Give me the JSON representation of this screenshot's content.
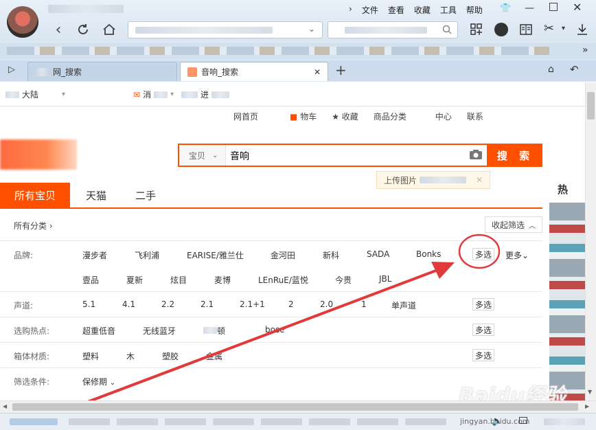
{
  "browser": {
    "menu": [
      "文件",
      "查看",
      "收藏",
      "工具",
      "帮助"
    ],
    "tabs": [
      {
        "label": "网_搜索"
      },
      {
        "label": "音响_搜索"
      }
    ],
    "favorites": [
      {
        "label": "大陆"
      },
      {
        "label": "消"
      },
      {
        "label": "进"
      }
    ]
  },
  "site": {
    "top_nav": [
      "网首页",
      "物车",
      "收藏",
      "商品分类",
      "中心",
      "联系"
    ],
    "search": {
      "category": "宝贝",
      "query": "音响",
      "button": "搜 索",
      "tip": "上传图片"
    },
    "tabs": [
      {
        "label": "所有宝贝",
        "active": true
      },
      {
        "label": "天猫",
        "active": false
      },
      {
        "label": "二手",
        "active": false
      }
    ],
    "breadcrumb": "所有分类",
    "collapse_filter": "收起筛选",
    "right_panel_title": "热",
    "filters": {
      "brand": {
        "label": "品牌:",
        "row1": [
          "漫步者",
          "飞利浦",
          "EARISE/雅兰仕",
          "金河田",
          "新科",
          "SADA",
          "Bonks"
        ],
        "row2": [
          "壹品",
          "夏新",
          "炫目",
          "麦博",
          "LEnRuE/蓝悦",
          "今贵",
          "JBL"
        ],
        "multi": "多选",
        "more": "更多"
      },
      "channel": {
        "label": "声道:",
        "items": [
          "5.1",
          "4.1",
          "2.2",
          "2.1",
          "2.1+1",
          "2",
          "2.0",
          "1",
          "单声道"
        ],
        "multi": "多选"
      },
      "hot": {
        "label": "选购热点:",
        "items": [
          "超重低音",
          "无线蓝牙",
          "顿",
          "bose"
        ],
        "multi": "多选"
      },
      "material": {
        "label": "箱体材质:",
        "items": [
          "塑料",
          "木",
          "塑胶",
          "金属"
        ],
        "multi": "多选"
      },
      "conditions": {
        "label": "筛选条件:",
        "items": [
          "保修期"
        ]
      }
    }
  },
  "watermark": {
    "brand": "Baidu经验",
    "url": "jingyan.baidu.com"
  },
  "colors": {
    "accent": "#ff5000",
    "annotation": "#e03a3a",
    "chrome": "#dbe7f3"
  }
}
